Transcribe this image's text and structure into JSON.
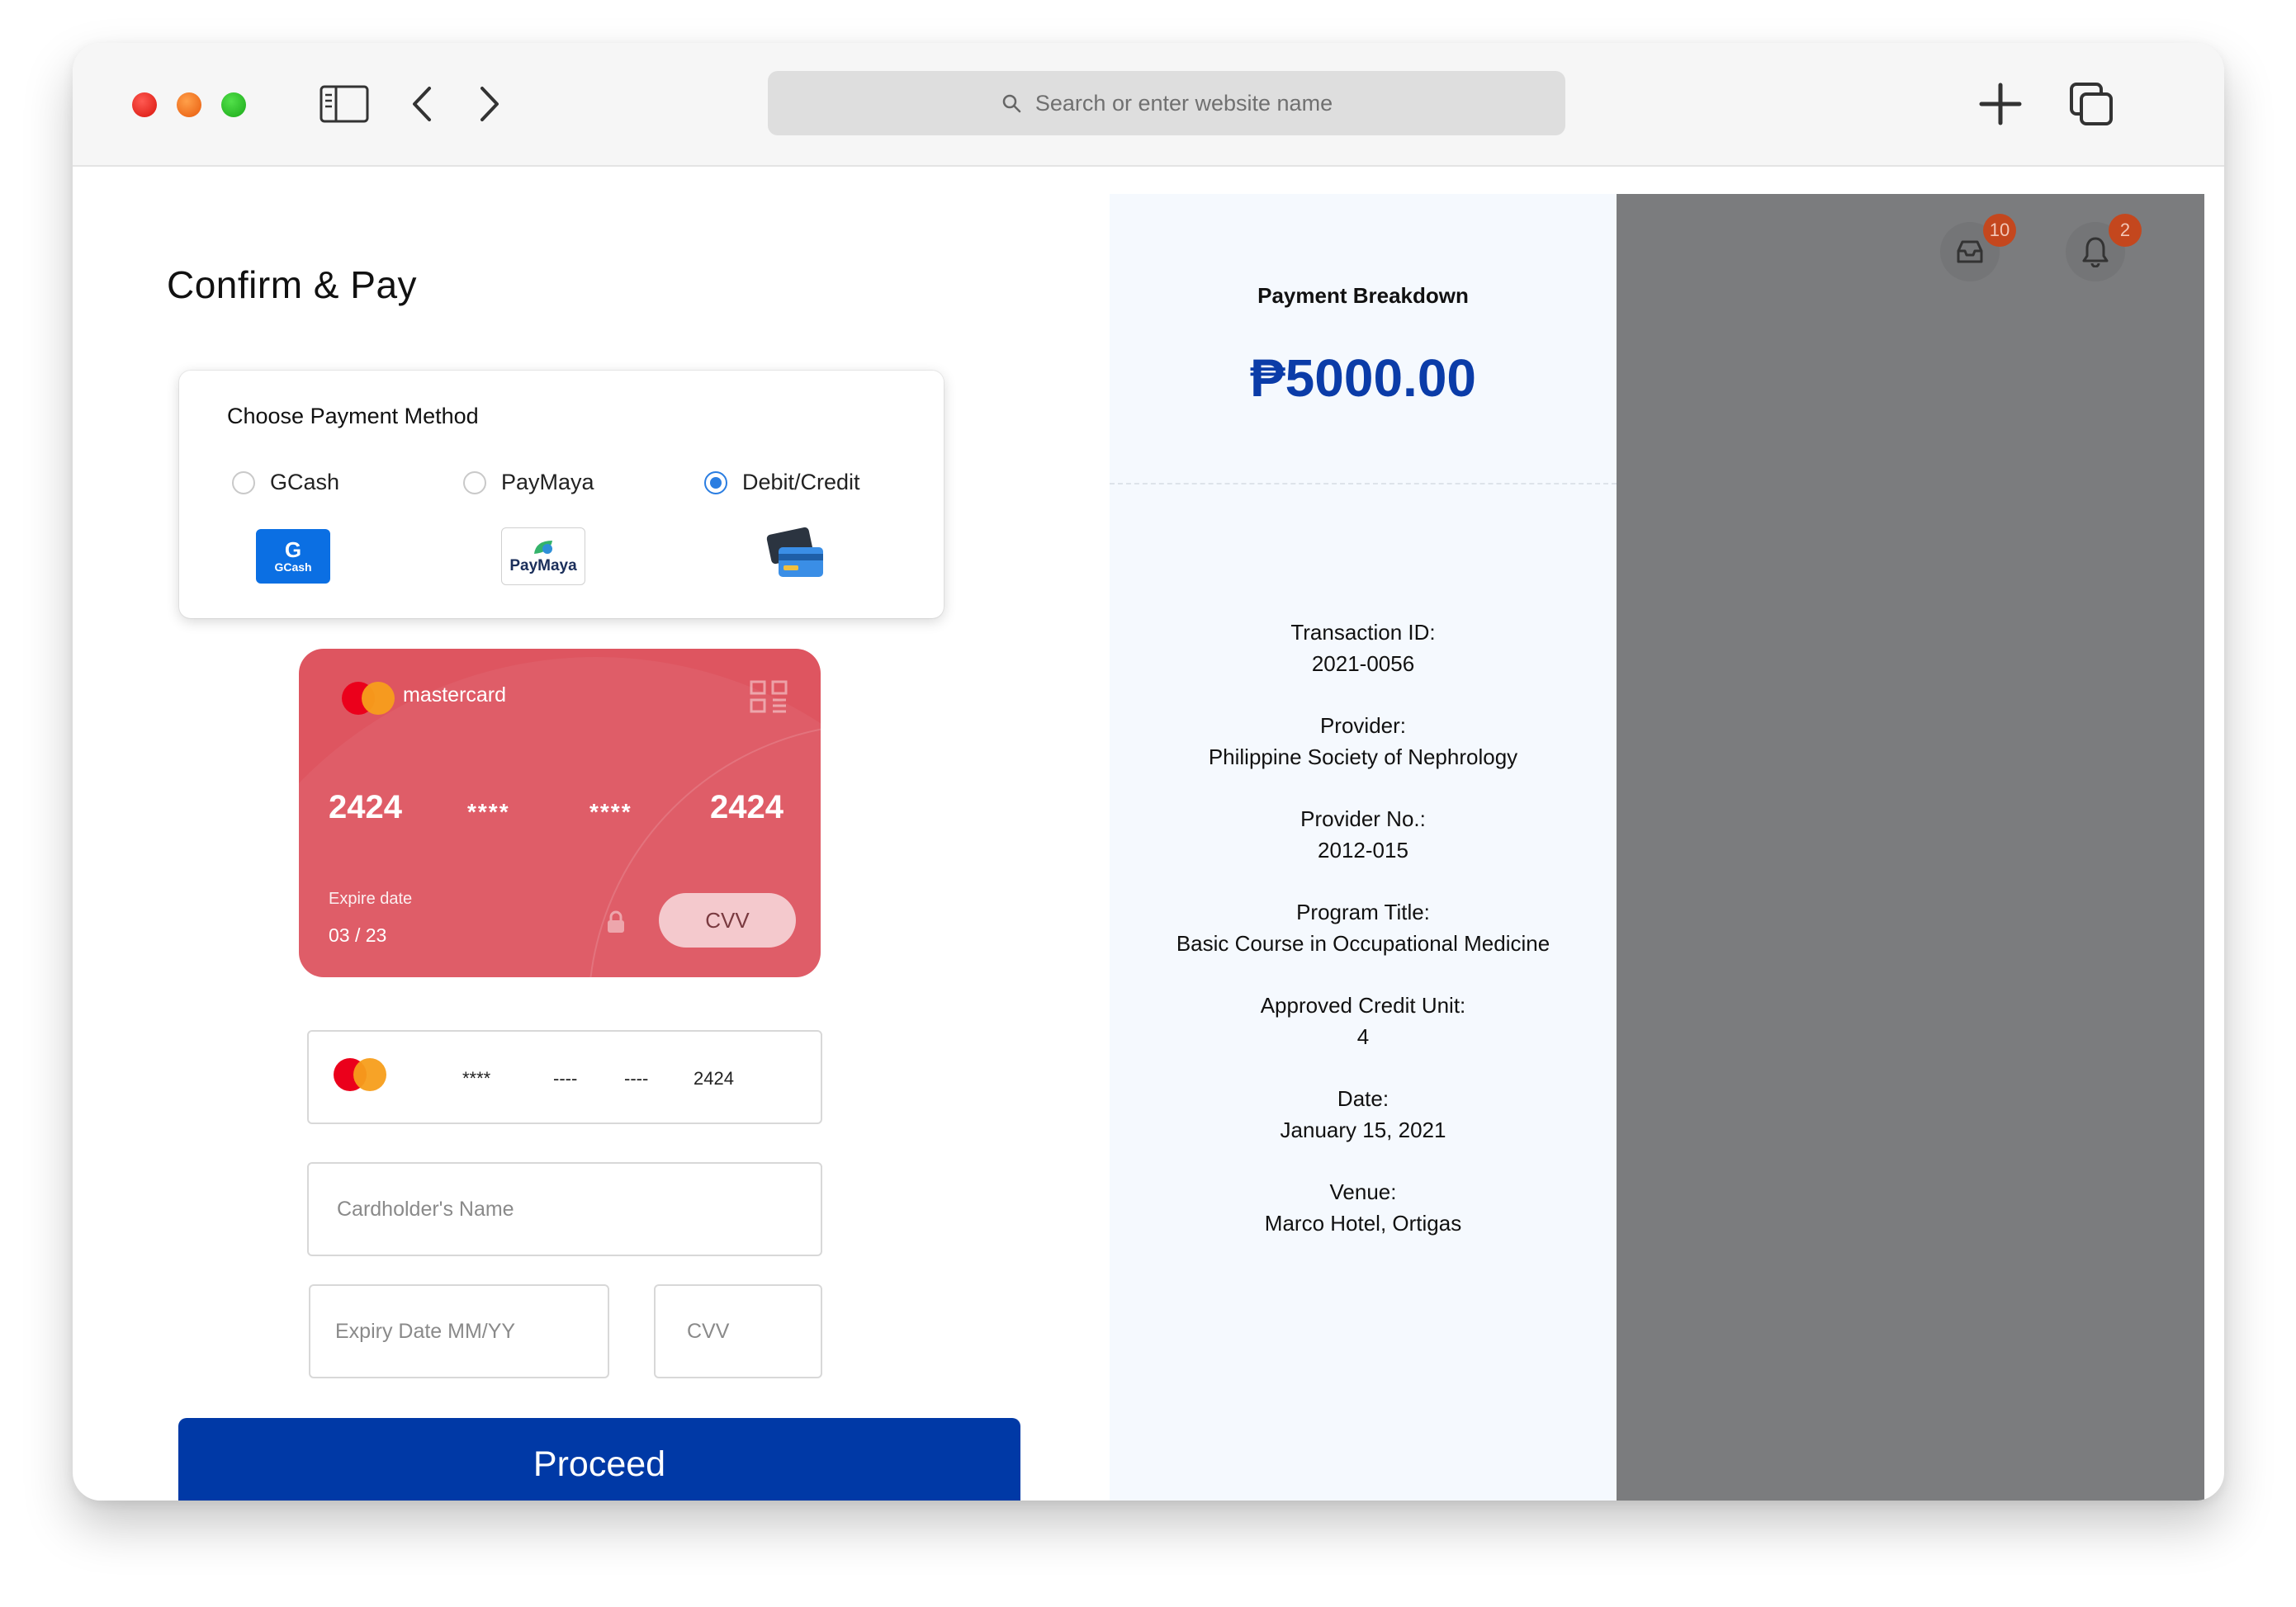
{
  "browser": {
    "search_placeholder": "Search or enter website name"
  },
  "page": {
    "title": "Confirm & Pay"
  },
  "payment_method": {
    "title": "Choose Payment Method",
    "options": [
      {
        "label": "GCash",
        "selected": false,
        "logo_text": "GCash"
      },
      {
        "label": "PayMaya",
        "selected": false,
        "logo_text": "PayMaya"
      },
      {
        "label": "Debit/Credit",
        "selected": true
      }
    ]
  },
  "card_preview": {
    "brand": "mastercard",
    "number_first": "2424",
    "number_mid1": "****",
    "number_mid2": "****",
    "number_last": "2424",
    "expire_label": "Expire date",
    "expire_value": "03 / 23",
    "cvv_label": "CVV"
  },
  "form": {
    "card_number_parts": [
      "****",
      "----",
      "----",
      "2424"
    ],
    "cardholder_placeholder": "Cardholder's Name",
    "expiry_placeholder": "Expiry Date MM/YY",
    "cvv_placeholder": "CVV",
    "proceed_label": "Proceed"
  },
  "breakdown": {
    "title": "Payment Breakdown",
    "amount": "₱5000.00",
    "details": [
      {
        "label": "Transaction ID:",
        "value": "2021-0056"
      },
      {
        "label": "Provider:",
        "value": "Philippine Society of Nephrology"
      },
      {
        "label": "Provider No.:",
        "value": "2012-015"
      },
      {
        "label": "Program Title:",
        "value": "Basic Course in Occupational Medicine"
      },
      {
        "label": "Approved Credit Unit:",
        "value": "4"
      },
      {
        "label": "Date:",
        "value": "January 15, 2021"
      },
      {
        "label": "Venue:",
        "value": "Marco Hotel, Ortigas"
      }
    ]
  },
  "header_icons": {
    "inbox_count": "10",
    "notification_count": "2"
  },
  "colors": {
    "primary": "#0039a6",
    "amount": "#0b3ca8",
    "card": "#de5560",
    "overlay": "#7b7c7e",
    "badge": "#c4471e",
    "radio_selected": "#2a7de1"
  }
}
